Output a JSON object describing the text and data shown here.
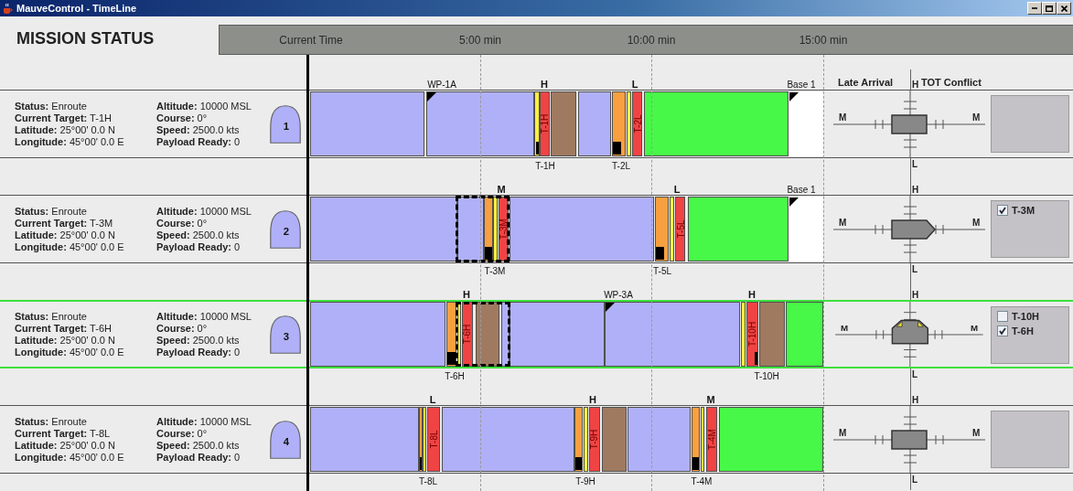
{
  "window": {
    "title": "MauveControl - TimeLine"
  },
  "header": {
    "title": "MISSION STATUS",
    "time_labels": [
      "Current Time",
      "5:00 min",
      "10:00 min",
      "15:00 min"
    ]
  },
  "columns": {
    "late_arrival": "Late Arrival",
    "tot_conflict": "TOT Conflict"
  },
  "vehicles": [
    {
      "number": "1",
      "selected": false,
      "fields": [
        {
          "label": "Status:",
          "value": "Enroute"
        },
        {
          "label": "Current Target:",
          "value": "T-1H"
        },
        {
          "label": "Latitude:",
          "value": "25°00' 0.0 N"
        },
        {
          "label": "Longitude:",
          "value": "45°00' 0.0 E"
        },
        {
          "label": "Altitude:",
          "value": "10000 MSL"
        },
        {
          "label": "Course:",
          "value": "0°"
        },
        {
          "label": "Speed:",
          "value": "2500.0 kts"
        },
        {
          "label": "Payload Ready:",
          "value": "0"
        }
      ],
      "marks_above": [
        {
          "kind": "waypoint",
          "text": "WP-1A"
        },
        {
          "kind": "priority",
          "text": "H"
        },
        {
          "kind": "priority",
          "text": "L"
        },
        {
          "kind": "waypoint",
          "text": "Base 1"
        }
      ],
      "segments": [
        {
          "kind": "transit"
        },
        {
          "kind": "transit",
          "flag": true
        },
        {
          "kind": "ready",
          "marker": true
        },
        {
          "kind": "strike",
          "label": "T-1H"
        },
        {
          "kind": "loiter"
        },
        {
          "kind": "transit"
        },
        {
          "kind": "approach",
          "marker": true
        },
        {
          "kind": "ready"
        },
        {
          "kind": "strike",
          "label": "T-2L"
        },
        {
          "kind": "return"
        },
        {
          "kind": "base",
          "flag": true
        }
      ],
      "marks_below": [
        "T-1H",
        "T-2L"
      ],
      "indicator": {
        "kind": "box",
        "top": "H",
        "bottom": "L",
        "left": "M",
        "right": "M"
      }
    },
    {
      "number": "2",
      "selected": false,
      "fields": [
        {
          "label": "Status:",
          "value": "Enroute"
        },
        {
          "label": "Current Target:",
          "value": "T-3M"
        },
        {
          "label": "Latitude:",
          "value": "25°00' 0.0 N"
        },
        {
          "label": "Longitude:",
          "value": "45°00' 0.0 E"
        },
        {
          "label": "Altitude:",
          "value": "10000 MSL"
        },
        {
          "label": "Course:",
          "value": "0°"
        },
        {
          "label": "Speed:",
          "value": "2500.0 kts"
        },
        {
          "label": "Payload Ready:",
          "value": "0"
        }
      ],
      "marks_above": [
        {
          "kind": "priority",
          "text": "M"
        },
        {
          "kind": "priority",
          "text": "L"
        },
        {
          "kind": "waypoint",
          "text": "Base 1"
        }
      ],
      "segments": [
        {
          "kind": "transit"
        },
        {
          "kind": "transit",
          "boxed": true
        },
        {
          "kind": "approach",
          "marker": true,
          "boxed": true
        },
        {
          "kind": "ready",
          "boxed": true
        },
        {
          "kind": "strike",
          "label": "T-3M",
          "boxed": true
        },
        {
          "kind": "transit"
        },
        {
          "kind": "approach",
          "marker": true
        },
        {
          "kind": "ready"
        },
        {
          "kind": "strike",
          "label": "T-5L"
        },
        {
          "kind": "return"
        },
        {
          "kind": "base",
          "flag": true
        }
      ],
      "marks_below": [
        "T-3M",
        "T-5L"
      ],
      "indicator": {
        "kind": "arrow",
        "top": "H",
        "bottom": "L",
        "left": "M",
        "right": "M"
      },
      "conflicts": [
        {
          "label": "T-3M",
          "checked": true
        }
      ]
    },
    {
      "number": "3",
      "selected": true,
      "fields": [
        {
          "label": "Status:",
          "value": "Enroute"
        },
        {
          "label": "Current Target:",
          "value": "T-6H"
        },
        {
          "label": "Latitude:",
          "value": "25°00' 0.0 N"
        },
        {
          "label": "Longitude:",
          "value": "45°00' 0.0 E"
        },
        {
          "label": "Altitude:",
          "value": "10000 MSL"
        },
        {
          "label": "Course:",
          "value": "0°"
        },
        {
          "label": "Speed:",
          "value": "2500.0 kts"
        },
        {
          "label": "Payload Ready:",
          "value": "0"
        }
      ],
      "marks_above": [
        {
          "kind": "priority",
          "text": "H"
        },
        {
          "kind": "waypoint",
          "text": "WP-3A"
        },
        {
          "kind": "priority",
          "text": "H"
        }
      ],
      "segments": [
        {
          "kind": "transit"
        },
        {
          "kind": "approach",
          "marker": true
        },
        {
          "kind": "ready",
          "boxed": true
        },
        {
          "kind": "strike",
          "label": "T-6H",
          "boxed": true
        },
        {
          "kind": "loiter",
          "boxed": true
        },
        {
          "kind": "transit",
          "boxed": true
        },
        {
          "kind": "transit"
        },
        {
          "kind": "transit",
          "flag": true
        },
        {
          "kind": "ready"
        },
        {
          "kind": "strike",
          "label": "T-10H",
          "marker": true
        },
        {
          "kind": "loiter"
        },
        {
          "kind": "return"
        }
      ],
      "marks_below": [
        "T-6H",
        "T-10H"
      ],
      "indicator": {
        "kind": "warning",
        "top": "H",
        "bottom": "L",
        "left": "M",
        "right": "M"
      },
      "conflicts": [
        {
          "label": "T-10H",
          "checked": false
        },
        {
          "label": "T-6H",
          "checked": true
        }
      ]
    },
    {
      "number": "4",
      "selected": false,
      "fields": [
        {
          "label": "Status:",
          "value": "Enroute"
        },
        {
          "label": "Current Target:",
          "value": "T-8L"
        },
        {
          "label": "Latitude:",
          "value": "25°00' 0.0 N"
        },
        {
          "label": "Longitude:",
          "value": "45°00' 0.0 E"
        },
        {
          "label": "Altitude:",
          "value": "10000 MSL"
        },
        {
          "label": "Course:",
          "value": "0°"
        },
        {
          "label": "Speed:",
          "value": "2500.0 kts"
        },
        {
          "label": "Payload Ready:",
          "value": "0"
        }
      ],
      "marks_above": [
        {
          "kind": "priority",
          "text": "L"
        },
        {
          "kind": "priority",
          "text": "H"
        },
        {
          "kind": "priority",
          "text": "M"
        }
      ],
      "segments": [
        {
          "kind": "transit"
        },
        {
          "kind": "approach",
          "marker": true
        },
        {
          "kind": "ready"
        },
        {
          "kind": "strike",
          "label": "T-8L"
        },
        {
          "kind": "transit"
        },
        {
          "kind": "approach",
          "marker": true
        },
        {
          "kind": "ready"
        },
        {
          "kind": "strike",
          "label": "T-9H"
        },
        {
          "kind": "loiter"
        },
        {
          "kind": "transit"
        },
        {
          "kind": "approach",
          "marker": true
        },
        {
          "kind": "ready"
        },
        {
          "kind": "strike",
          "label": "T-4M"
        },
        {
          "kind": "return"
        }
      ],
      "marks_below": [
        "T-8L",
        "T-9H",
        "T-4M"
      ],
      "indicator": {
        "kind": "box",
        "top": "H",
        "bottom": "L",
        "left": "M",
        "right": "M"
      }
    }
  ]
}
